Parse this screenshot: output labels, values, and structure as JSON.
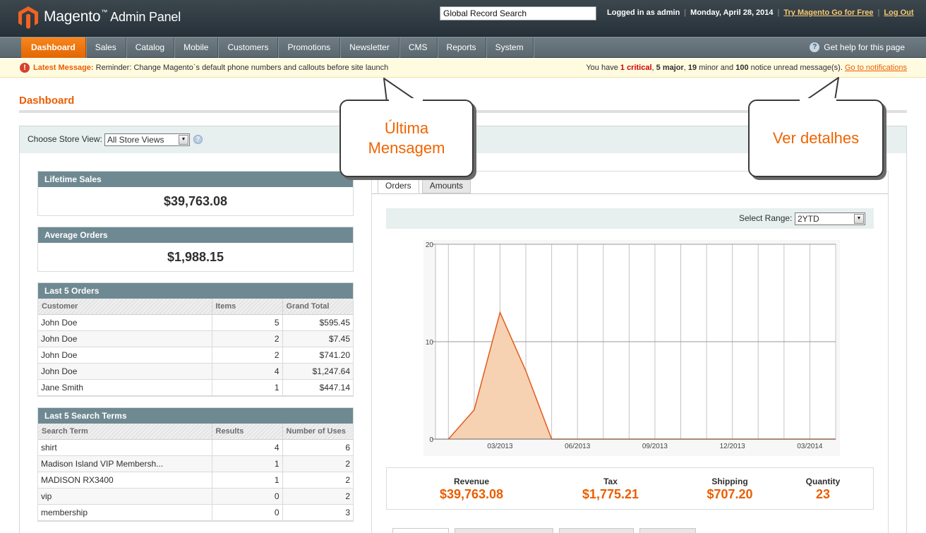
{
  "header": {
    "brand": "Magento",
    "brand_tm": "™",
    "brand_sub": "Admin Panel",
    "search_value": "Global Record Search",
    "logged_in": "Logged in as admin",
    "date": "Monday, April 28, 2014",
    "try_link": "Try Magento Go for Free",
    "logout_link": "Log Out"
  },
  "nav": {
    "items": [
      "Dashboard",
      "Sales",
      "Catalog",
      "Mobile",
      "Customers",
      "Promotions",
      "Newsletter",
      "CMS",
      "Reports",
      "System"
    ],
    "active": "Dashboard",
    "help": "Get help for this page",
    "help_icon": "?"
  },
  "notice": {
    "icon": "!",
    "label": "Latest Message:",
    "text": "Reminder: Change Magento`s default phone numbers and callouts before site launch",
    "summary_pre": "You have",
    "critical": "1 critical",
    "major": "5 major",
    "minor": "19",
    "minor_label": "minor and",
    "notice_count": "100",
    "notice_label": "notice unread message(s).",
    "link": "Go to notifications"
  },
  "page": {
    "title": "Dashboard",
    "store_label": "Choose Store View:",
    "store_value": "All Store Views"
  },
  "lifetime_sales": {
    "title": "Lifetime Sales",
    "value": "$39,763.08"
  },
  "average_orders": {
    "title": "Average Orders",
    "value": "$1,988.15"
  },
  "last_orders": {
    "title": "Last 5 Orders",
    "columns": [
      "Customer",
      "Items",
      "Grand Total"
    ],
    "rows": [
      [
        "John Doe",
        "5",
        "$595.45"
      ],
      [
        "John Doe",
        "2",
        "$7.45"
      ],
      [
        "John Doe",
        "2",
        "$741.20"
      ],
      [
        "John Doe",
        "4",
        "$1,247.64"
      ],
      [
        "Jane Smith",
        "1",
        "$447.14"
      ]
    ]
  },
  "last_search": {
    "title": "Last 5 Search Terms",
    "columns": [
      "Search Term",
      "Results",
      "Number of Uses"
    ],
    "rows": [
      [
        "shirt",
        "4",
        "6"
      ],
      [
        "Madison Island VIP Membersh...",
        "1",
        "2"
      ],
      [
        "MADISON RX3400",
        "1",
        "2"
      ],
      [
        "vip",
        "0",
        "2"
      ],
      [
        "membership",
        "0",
        "3"
      ]
    ]
  },
  "tabs": [
    "Orders",
    "Amounts"
  ],
  "range": {
    "label": "Select Range:",
    "value": "2YTD"
  },
  "chart_data": {
    "type": "area",
    "x": [
      "01/2013",
      "02/2013",
      "03/2013",
      "04/2013",
      "05/2013",
      "06/2013",
      "07/2013",
      "08/2013",
      "09/2013",
      "10/2013",
      "11/2013",
      "12/2013",
      "01/2014",
      "02/2014",
      "03/2014",
      "04/2014"
    ],
    "x_tick_labels": [
      "03/2013",
      "06/2013",
      "09/2013",
      "12/2013",
      "03/2014"
    ],
    "series": [
      {
        "values": [
          0,
          3,
          13,
          7,
          0,
          0,
          0,
          0,
          0,
          0,
          0,
          0,
          0,
          0,
          0,
          0
        ]
      }
    ],
    "y_ticks": [
      "0",
      "10",
      "20"
    ],
    "ylim": [
      0,
      20
    ],
    "grid": true,
    "fill_color": "#f6d2b3",
    "line_color": "#e25a1c"
  },
  "totals": [
    {
      "label": "Revenue",
      "value": "$39,763.08"
    },
    {
      "label": "Tax",
      "value": "$1,775.21"
    },
    {
      "label": "Shipping",
      "value": "$707.20"
    },
    {
      "label": "Quantity",
      "value": "23"
    }
  ],
  "callouts": {
    "latest": "Última Mensagem",
    "details": "Ver detalhes"
  },
  "colors": {
    "accent": "#eb5e00",
    "header": "#2b363d",
    "panel_header": "#6f8992"
  }
}
